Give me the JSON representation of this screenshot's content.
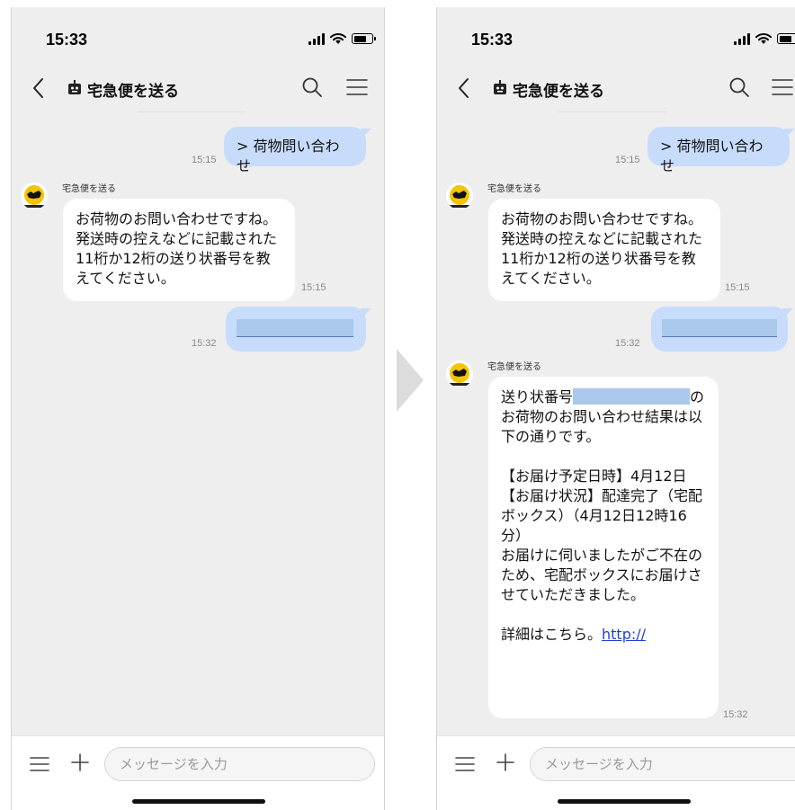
{
  "colors": {
    "outgoing_bubble": "#c7dcfb",
    "incoming_bubble": "#ffffff",
    "chat_background": "#eeeeee",
    "link": "#1f3fd6",
    "redaction": "#a9c8ec"
  },
  "left": {
    "status": {
      "time": "15:33"
    },
    "header": {
      "title": "宅急便を送る"
    },
    "messages": {
      "m1": {
        "text": "> 荷物問い合わせ",
        "time": "15:15"
      },
      "m2": {
        "sender": "宅急便を送る",
        "lines": [
          "お荷物のお問い合わせですね。",
          "発送時の控えなどに記載された",
          "11桁か12桁の送り状番号を教",
          "えてください。"
        ],
        "time": "15:15"
      },
      "m3": {
        "time": "15:32"
      }
    },
    "input": {
      "placeholder": "メッセージを入力"
    }
  },
  "right": {
    "status": {
      "time": "15:33"
    },
    "header": {
      "title": "宅急便を送る"
    },
    "messages": {
      "m1": {
        "text": "> 荷物問い合わせ",
        "time": "15:15"
      },
      "m2": {
        "sender": "宅急便を送る",
        "lines": [
          "お荷物のお問い合わせですね。",
          "発送時の控えなどに記載された",
          "11桁か12桁の送り状番号を教",
          "えてください。"
        ],
        "time": "15:15"
      },
      "m3": {
        "time": "15:32"
      },
      "m4": {
        "sender": "宅急便を送る",
        "prefix": "送り状番号",
        "suffix": "の",
        "lines": [
          "お荷物のお問い合わせ結果は以",
          "下の通りです。",
          "",
          "【お届け予定日時】4月12日",
          "【お届け状況】配達完了（宅配",
          "ボックス）（4月12日12時16",
          "分）",
          "お届けに伺いましたがご不在の",
          "ため、宅配ボックスにお届けさ",
          "せていただきました。",
          ""
        ],
        "detail_text": "詳細はこちら。",
        "link_text": "http://",
        "time": "15:32"
      }
    },
    "input": {
      "placeholder": "メッセージを入力"
    }
  },
  "icons": {
    "back": "chevron-left-icon",
    "bot": "bot-icon",
    "search": "search-icon",
    "menu": "hamburger-menu-icon",
    "plus": "plus-icon",
    "avatar": "black-cat-logo-icon",
    "flow": "arrow-right-icon"
  }
}
